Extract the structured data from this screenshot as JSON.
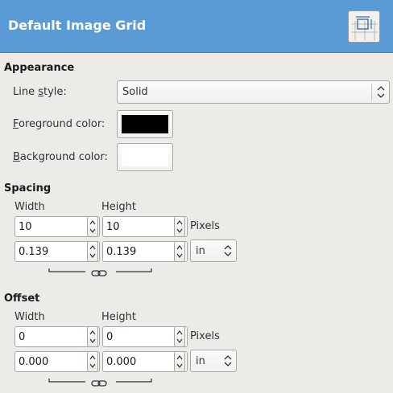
{
  "header": {
    "title": "Default Image Grid",
    "icon": "grid-icon"
  },
  "appearance": {
    "title": "Appearance",
    "line_style": {
      "label_pre": "Line ",
      "label_u": "s",
      "label_post": "tyle:",
      "value": "Solid"
    },
    "foreground": {
      "label_u": "F",
      "label_post": "oreground color:",
      "color": "#000000"
    },
    "background": {
      "label_u": "B",
      "label_post": "ackground color:",
      "color": "#ffffff"
    }
  },
  "spacing": {
    "title": "Spacing",
    "width_label": "Width",
    "height_label": "Height",
    "width_px": "10",
    "height_px": "10",
    "px_unit": "Pixels",
    "width_in": "0.139",
    "height_in": "0.139",
    "unit": "in",
    "chain_icon": "chain-link-icon"
  },
  "offset": {
    "title": "Offset",
    "width_label": "Width",
    "height_label": "Height",
    "width_px": "0",
    "height_px": "0",
    "px_unit": "Pixels",
    "width_in": "0.000",
    "height_in": "0.000",
    "unit": "in",
    "chain_icon": "chain-link-icon"
  }
}
